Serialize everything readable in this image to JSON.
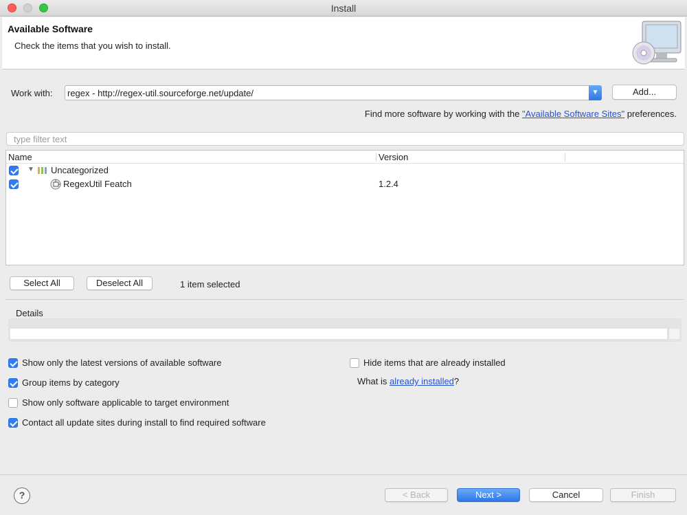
{
  "window": {
    "title": "Install"
  },
  "banner": {
    "title": "Available Software",
    "description": "Check the items that you wish to install."
  },
  "work_with": {
    "label": "Work with:",
    "value": "regex - http://regex-util.sourceforge.net/update/",
    "add_label": "Add..."
  },
  "find_more": {
    "prefix": "Find more software by working with the ",
    "link": "\"Available Software Sites\"",
    "suffix": " preferences."
  },
  "filter": {
    "placeholder": "type filter text"
  },
  "table": {
    "columns": [
      "Name",
      "Version"
    ],
    "rows": [
      {
        "name": "Uncategorized",
        "version": "",
        "checked": true,
        "type": "category",
        "expanded": true
      },
      {
        "name": "RegexUtil Featch",
        "version": "1.2.4",
        "checked": true,
        "type": "feature"
      }
    ]
  },
  "selection": {
    "select_all": "Select All",
    "deselect_all": "Deselect All",
    "count_text": "1 item selected"
  },
  "details": {
    "label": "Details"
  },
  "options": {
    "latest_only": {
      "label": "Show only the latest versions of available software",
      "checked": true
    },
    "group_by_category": {
      "label": "Group items by category",
      "checked": true
    },
    "target_env": {
      "label": "Show only software applicable to target environment",
      "checked": false
    },
    "contact_sites": {
      "label": "Contact all update sites during install to find required software",
      "checked": true
    },
    "hide_installed": {
      "label": "Hide items that are already installed",
      "checked": false
    },
    "what_is_prefix": "What is ",
    "what_is_link": "already installed",
    "what_is_suffix": "?"
  },
  "footer": {
    "help": "?",
    "back": "< Back",
    "next": "Next >",
    "cancel": "Cancel",
    "finish": "Finish"
  },
  "colors": {
    "accent": "#2e7cf6",
    "link": "#2352d8"
  }
}
